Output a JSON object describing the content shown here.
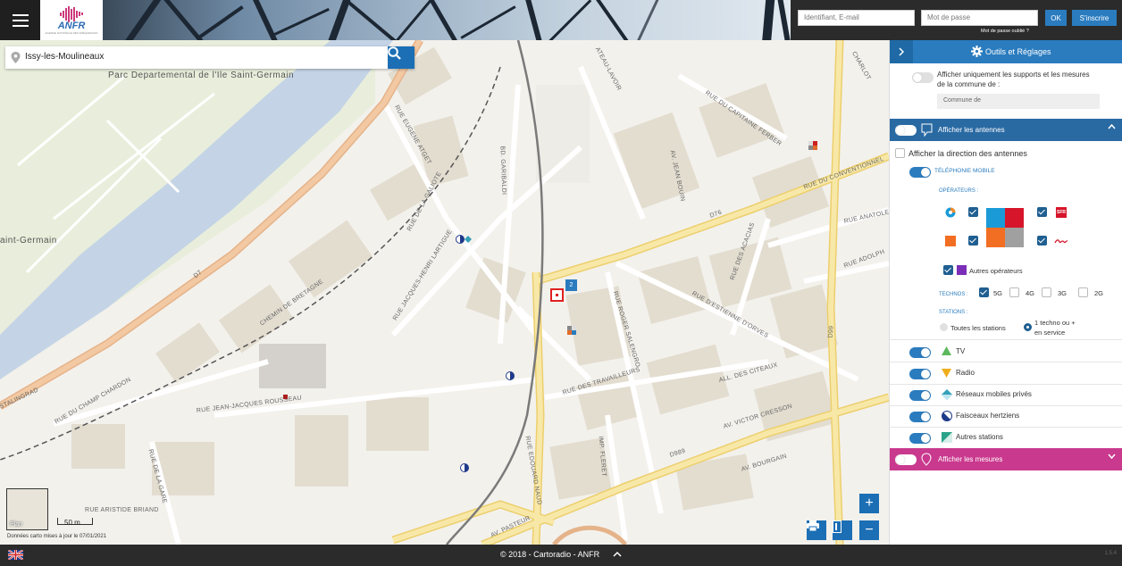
{
  "header": {
    "logo_text": "ANFR",
    "logo_tagline": "AGENCE NATIONALE DES FRÉQUENCES",
    "login_placeholder": "Identifiant, E-mail",
    "password_placeholder": "Mot de passe",
    "ok_label": "OK",
    "signup_label": "S'inscrire",
    "forgot_label": "Mot de passe oublié ?"
  },
  "search": {
    "value": "Issy-les-Moulineaux",
    "icon": "search-icon"
  },
  "map": {
    "labels": {
      "park": "Parc Departemental de l'Ile Saint-Germain",
      "saint_germain": "aint-Germain",
      "eugene_atget": "RUE EUGENE ATGET",
      "galiote": "RUE DE LA GALIOTE",
      "garibaldi": "BD. GARIBALDI",
      "lavoir": "ATEAU-LAVOIR",
      "capitaine": "RUE DU CAPITAINE FERBER",
      "jean_bouin": "AV. JEAN BOUIN",
      "chemin_bretagne": "CHEMIN DE BRETAGNE",
      "lartigue": "RUE JACQUES-HENRI LARTIGUE",
      "roger_salengro": "RUE ROGER SALENGRO",
      "estienne": "RUE D'ESTIENNE D'ORVES",
      "acacias": "RUE DES ACACIAS",
      "travailleurs": "RUE DES TRAVAILLEURS",
      "citeaux": "ALL. DES CITEAUX",
      "champ_chardon": "RUE DU CHAMP CHARDON",
      "rousseau": "RUE JEAN-JACQUES ROUSSEAU",
      "edouard_naud": "RUE EDOUARD NAUD",
      "fleret": "IMP. FLERET",
      "victor_cresson": "AV. VICTOR CRESSON",
      "bourgain": "AV. BOURGAIN",
      "aristide": "RUE ARISTIDE BRIAND",
      "gare": "RUE DE LA GARE",
      "pasteur": "AV. PASTEUR",
      "d7": "D7",
      "d76": "D76",
      "d989": "D989",
      "d99": "D99",
      "stalingrad": "STALINGRAD",
      "anatole": "RUE ANATOLE",
      "adolphe": "RUE ADOLPH",
      "charlot": "CHARLOT",
      "lafran": "RUE DU CONVENTIONNEL"
    },
    "cluster_count": "2",
    "minimap_label": "Plan",
    "scale_label": "50 m",
    "attribution": "Données carto mises à jour le 07/01/2021",
    "zoom_in": "+",
    "zoom_out": "−"
  },
  "panel": {
    "title": "Outils et Réglages",
    "commune_only_label": "Afficher uniquement les supports et les mesures de la commune de :",
    "commune_placeholder": "Commune de",
    "antennas_section": "Afficher les antennes",
    "antenna_direction": "Afficher la direction des antennes",
    "mobile_label": "TÉLÉPHONIE MOBILE",
    "operators_label": "OPÉRATEURS :",
    "other_operators": "Autres opérateurs",
    "technos_label": "TECHNOS :",
    "technos": [
      {
        "label": "5G",
        "checked": true
      },
      {
        "label": "4G",
        "checked": false
      },
      {
        "label": "3G",
        "checked": false
      },
      {
        "label": "2G",
        "checked": false
      }
    ],
    "stations_label": "STATIONS :",
    "all_stations": "Toutes les stations",
    "one_techno": "1 techno ou +",
    "in_service": "en service",
    "layers": [
      {
        "label": "TV",
        "icon": "tv-triangle-icon",
        "color": "#5cb85c"
      },
      {
        "label": "Radio",
        "icon": "radio-triangle-icon",
        "color": "#f0ad1e"
      },
      {
        "label": "Réseaux mobiles privés",
        "icon": "diamond-icon",
        "color": "#34a0b8"
      },
      {
        "label": "Faisceaux hertziens",
        "icon": "half-circle-icon",
        "color": "#1f3a8a"
      },
      {
        "label": "Autres stations",
        "icon": "corner-icon",
        "color": "#2aa38a"
      }
    ],
    "measures_section": "Afficher les mesures"
  },
  "footer": {
    "text": "© 2018 - Cartoradio - ANFR",
    "version": "1.5.4"
  },
  "colors": {
    "accent": "#2a7cbf",
    "measures": "#c9398e",
    "road": "#f1d98a"
  }
}
